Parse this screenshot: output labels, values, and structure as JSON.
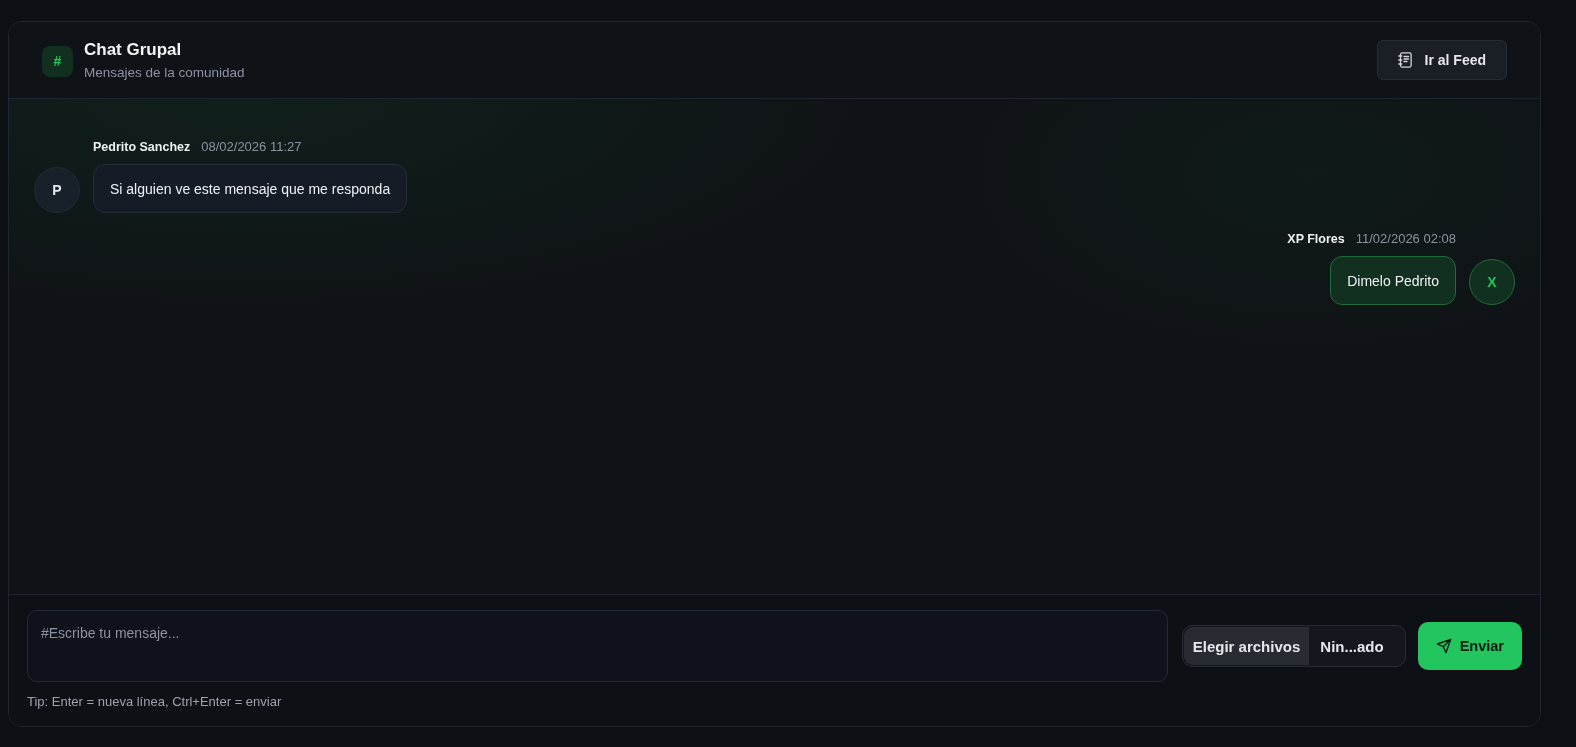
{
  "header": {
    "icon_text": "#",
    "title": "Chat Grupal",
    "subtitle": "Mensajes de la comunidad",
    "feed_button": "Ir al Feed"
  },
  "messages": [
    {
      "author": "Pedrito Sanchez",
      "time": "08/02/2026 11:27",
      "text": "Si alguien ve este mensaje que me responda",
      "avatar": "P",
      "own": false
    },
    {
      "author": "XP Flores",
      "time": "11/02/2026 02:08",
      "text": "Dimelo Pedrito",
      "avatar": "X",
      "own": true
    }
  ],
  "composer": {
    "placeholder": "#Escribe tu mensaje...",
    "file_button": "Elegir archivos",
    "file_status": "Nin...ado",
    "send_button": "Enviar",
    "tip": "Tip: Enter = nueva línea, Ctrl+Enter = enviar"
  }
}
